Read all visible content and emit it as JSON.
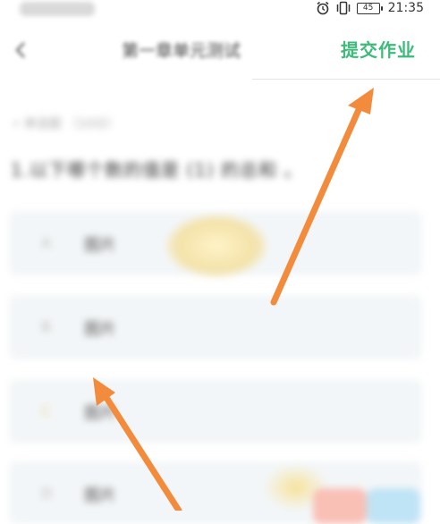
{
  "status_bar": {
    "time": "21:35",
    "battery": "45",
    "icons": [
      "alarm-icon",
      "vibrate-icon",
      "battery-icon"
    ]
  },
  "header": {
    "title": "第一章单元测试",
    "submit_label": "提交作业",
    "back_icon": "chevron-left-icon"
  },
  "question": {
    "meta": "• 单选题 （10分）",
    "text": "1.以下哪个数的值是 (1) 的总和 。"
  },
  "options": [
    {
      "key": "A",
      "label": "图片"
    },
    {
      "key": "B",
      "label": "图片"
    },
    {
      "key": "C",
      "label": "图片"
    },
    {
      "key": "D",
      "label": "图片"
    }
  ],
  "colors": {
    "accent": "#3dbb7a",
    "arrow": "#f28c3c"
  }
}
